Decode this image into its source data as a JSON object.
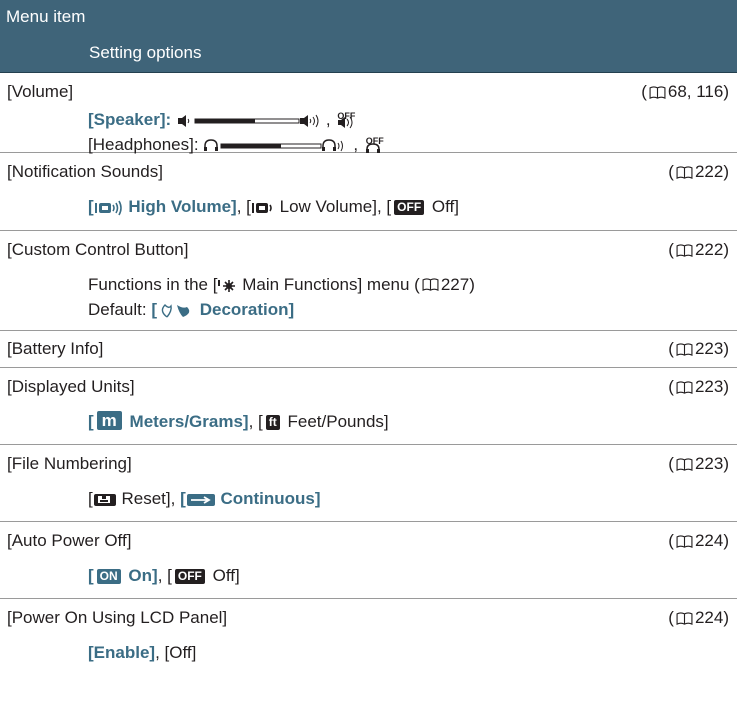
{
  "header": {
    "menu_item": "Menu item",
    "setting_options": "Setting options"
  },
  "rows": [
    {
      "title": "[Volume]",
      "ref": "68, 116",
      "speaker_label": "[Speaker]:",
      "headphones_label": "[Headphones]:",
      "off_mark": "OFF",
      "sep": ","
    },
    {
      "title": "[Notification Sounds]",
      "ref": "222",
      "opt1": "High Volume",
      "opt2": "Low Volume",
      "opt3_mark": "OFF",
      "opt3": "Off"
    },
    {
      "title": "[Custom Control Button]",
      "ref": "222",
      "functions_pre": "Functions in the [",
      "functions_name": "Main Functions] menu (",
      "functions_ref": "227",
      "functions_post": ")",
      "default_label": "Default:",
      "default_value": "Decoration]"
    },
    {
      "title": "[Battery Info]",
      "ref": "223"
    },
    {
      "title": "[Displayed Units]",
      "ref": "223",
      "opt1_mark": "m",
      "opt1": "Meters/Grams",
      "opt2_mark": "ft",
      "opt2": "Feet/Pounds"
    },
    {
      "title": "[File Numbering]",
      "ref": "223",
      "opt1": "Reset",
      "opt2": "Continuous"
    },
    {
      "title": "[Auto Power Off]",
      "ref": "224",
      "opt1_mark": "ON",
      "opt1": "On",
      "opt2_mark": "OFF",
      "opt2": "Off"
    },
    {
      "title": "[Power On Using LCD Panel]",
      "ref": "224",
      "opt1": "[Enable]",
      "opt2": "[Off]"
    }
  ],
  "colors": {
    "header_bg": "#3f6479",
    "highlight": "#3b6d85",
    "text": "#231f20"
  },
  "icons": [
    "book-reference-icon",
    "speaker-low-icon",
    "speaker-high-icon",
    "speaker-off-icon",
    "headphones-low-icon",
    "headphones-high-icon",
    "headphones-off-icon",
    "high-volume-icon",
    "low-volume-icon",
    "main-functions-icon",
    "decoration-icon",
    "reset-icon",
    "continuous-icon"
  ]
}
